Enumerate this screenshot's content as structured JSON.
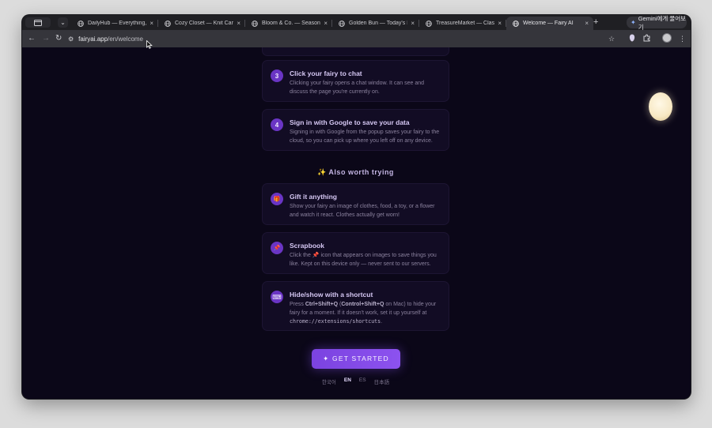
{
  "browser": {
    "tabs": [
      {
        "title": "DailyHub — Everything, To"
      },
      {
        "title": "Cozy Closet — Knit Cardig"
      },
      {
        "title": "Bloom & Co. — Seasonal B"
      },
      {
        "title": "Golden Bun — Today's Me"
      },
      {
        "title": "TreasureMarket — Classic"
      },
      {
        "title": "Welcome — Fairy AI"
      }
    ],
    "active_tab": 5,
    "new_tab_label": "+",
    "close_label": "×",
    "gemini_label": "Gemini에게 물어보기",
    "url_host": "fairyai.app",
    "url_path": "/en/welcome"
  },
  "steps": [
    {
      "num": "3",
      "title": "Click your fairy to chat",
      "desc": "Clicking your fairy opens a chat window. It can see and discuss the page you're currently on."
    },
    {
      "num": "4",
      "title": "Sign in with Google to save your data",
      "desc": "Signing in with Google from the popup saves your fairy to the cloud, so you can pick up where you left off on any device."
    }
  ],
  "section_title": "✨ Also worth trying",
  "extras": [
    {
      "icon": "gift-icon",
      "glyph": "🎁",
      "title": "Gift it anything",
      "desc": "Show your fairy an image of clothes, food, a toy, or a flower and watch it react. Clothes actually get worn!"
    },
    {
      "icon": "pin-icon",
      "glyph": "📌",
      "title": "Scrapbook",
      "desc_pre": "Click the ",
      "desc_glyph": "📌",
      "desc_post": " icon that appears on images to save things you like. Kept on this device only — never sent to our servers."
    },
    {
      "icon": "keyboard-icon",
      "glyph": "⌨",
      "title": "Hide/show with a shortcut",
      "desc_a": "Press ",
      "key1": "Ctrl+Shift+Q",
      "desc_b": " (",
      "key2": "Control+Shift+Q",
      "desc_c": " on Mac) to hide your fairy for a moment. If it doesn't work, set it up yourself at ",
      "code": "chrome://extensions/shortcuts",
      "desc_d": "."
    }
  ],
  "cta_label": "✦ GET STARTED",
  "languages": [
    "한국어",
    "EN",
    "ES",
    "日本語"
  ],
  "active_language": "EN"
}
